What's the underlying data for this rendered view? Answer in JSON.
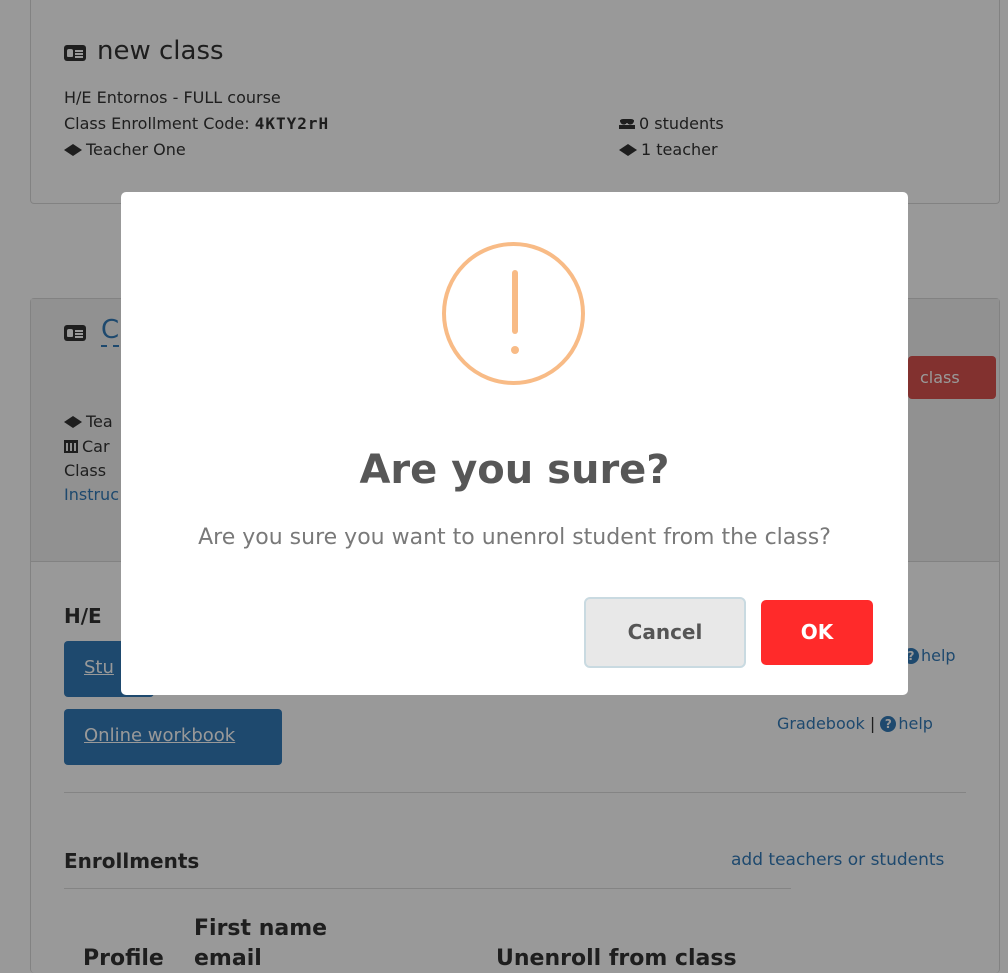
{
  "class1": {
    "title": "new class",
    "course": "H/E Entornos - FULL course",
    "code_label": "Class Enrollment Code: ",
    "code": "4KTY2rH",
    "teacher": "Teacher One",
    "students_count": "0 students",
    "teachers_count": "1 teacher"
  },
  "class2": {
    "title_partial": "C",
    "delete_label_partial": "class",
    "teacher_partial": "Tea",
    "campus_partial": "Car",
    "class_partial": "Class",
    "instructions_partial": "Instruc",
    "section_partial": "H/E",
    "student_btn_partial": "Stu",
    "help_label": "help",
    "workbook_label": "Online workbook",
    "gradebook_label": "Gradebook",
    "separator": "|",
    "enrollments_title": "Enrollments",
    "add_link": "add teachers or students",
    "table_headers": {
      "profile": "Profile",
      "first_name": "First name",
      "email": "email",
      "unenroll": "Unenroll from class"
    }
  },
  "dialog": {
    "title": "Are you sure?",
    "message": "Are you sure you want to unenrol student from the class?",
    "cancel_label": "Cancel",
    "ok_label": "OK"
  },
  "icons": {
    "help_glyph": "?"
  },
  "colors": {
    "warning": "#f8bb86",
    "ok_button": "#ff2a2a",
    "primary": "#337ab7",
    "danger": "#d9534f"
  }
}
